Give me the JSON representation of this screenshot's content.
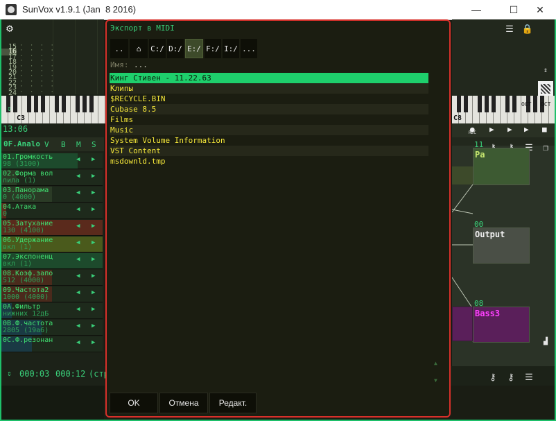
{
  "window": {
    "title": "SunVox v1.9.1 (Jan  8 2016)",
    "minimize": "—",
    "maximize": "☐",
    "close": "✕"
  },
  "pattern": {
    "rows": [
      "15",
      "16",
      "17",
      "18",
      "19",
      "20",
      "21",
      "22",
      "23",
      "24"
    ],
    "highlight_row": "16"
  },
  "keyboard": {
    "left_octave": "C3",
    "right_octave": "C8"
  },
  "left": {
    "time": "13:06",
    "module_name": "0F.Analo",
    "cols": [
      "V",
      "B",
      "M",
      "S"
    ],
    "controllers": [
      {
        "name": "01.Громкость",
        "value": "98 (3100)",
        "fill": 0.75,
        "color": "#1d4a2c"
      },
      {
        "name": "02.Форма вол",
        "value": "пила (1)",
        "fill": 0.15,
        "color": "#2b3b26"
      },
      {
        "name": "03.Панорама",
        "value": "0 (4000)",
        "fill": 0.5,
        "color": "#2b3b26"
      },
      {
        "name": "04.Атака",
        "value": "0",
        "fill": 0.05,
        "color": "#5a2a1c"
      },
      {
        "name": "05.Затухание",
        "value": "130 (4100)",
        "fill": 1.0,
        "color": "#5a2a1c"
      },
      {
        "name": "06.Удержание",
        "value": "вкл (1)",
        "fill": 1.0,
        "color": "#4a5a1c"
      },
      {
        "name": "07.Экспоненц",
        "value": "вкл (1)",
        "fill": 1.0,
        "color": "#1d4a2c"
      },
      {
        "name": "08.Коэф.запо",
        "value": "512 (4000)",
        "fill": 0.5,
        "color": "#4a2a1c"
      },
      {
        "name": "09.Частота2",
        "value": "1000 (4000)",
        "fill": 0.5,
        "color": "#4a2a1c"
      },
      {
        "name": "0A.Фильтр",
        "value": "нижних 12дБ",
        "fill": 0.1,
        "color": "#1a3a44"
      },
      {
        "name": "0B.Ф.частота",
        "value": "2805 (19a6)",
        "fill": 0.4,
        "color": "#1a3a44"
      },
      {
        "name": "0C.Ф.резонан",
        "value": "",
        "fill": 0.3,
        "color": "#1a3a44"
      }
    ]
  },
  "bottom": {
    "time_a": "000:03",
    "time_b": "000:12",
    "suffix": "(стр"
  },
  "right": {
    "transport": {
      "rec": "REC"
    },
    "oct_label": "OCT",
    "modules": [
      {
        "num": "11",
        "label": "Pa",
        "color": "#3d5a32",
        "text_color": "#c8e870"
      },
      {
        "num": "00",
        "label": "Output",
        "color": "#4a4f46",
        "text_color": "#f0f0f0"
      },
      {
        "num": "08",
        "label": "Bass3",
        "color": "#5a1f5a",
        "text_color": "#ff40ff"
      }
    ]
  },
  "dialog": {
    "title": "Экспорт в MIDI",
    "toolbar": [
      "..",
      "⌂",
      "C:/",
      "D:/",
      "E:/",
      "F:/",
      "I:/",
      "..."
    ],
    "active_drive": "E:/",
    "name_label": "Имя:",
    "name_value": "...",
    "files": [
      {
        "name": "Кинг Стивен - 11.22.63",
        "type": "dir",
        "selected": true
      },
      {
        "name": "Клипы",
        "type": "dir"
      },
      {
        "name": "$RECYCLE.BIN",
        "type": "dir"
      },
      {
        "name": "Cubase 8.5",
        "type": "dir"
      },
      {
        "name": "Films",
        "type": "dir"
      },
      {
        "name": "Music",
        "type": "dir"
      },
      {
        "name": "System Volume Information",
        "type": "dir"
      },
      {
        "name": "VST Content",
        "type": "dir"
      },
      {
        "name": "msdownld.tmp",
        "type": "dir"
      }
    ],
    "buttons": {
      "ok": "OK",
      "cancel": "Отмена",
      "edit": "Редакт."
    }
  }
}
